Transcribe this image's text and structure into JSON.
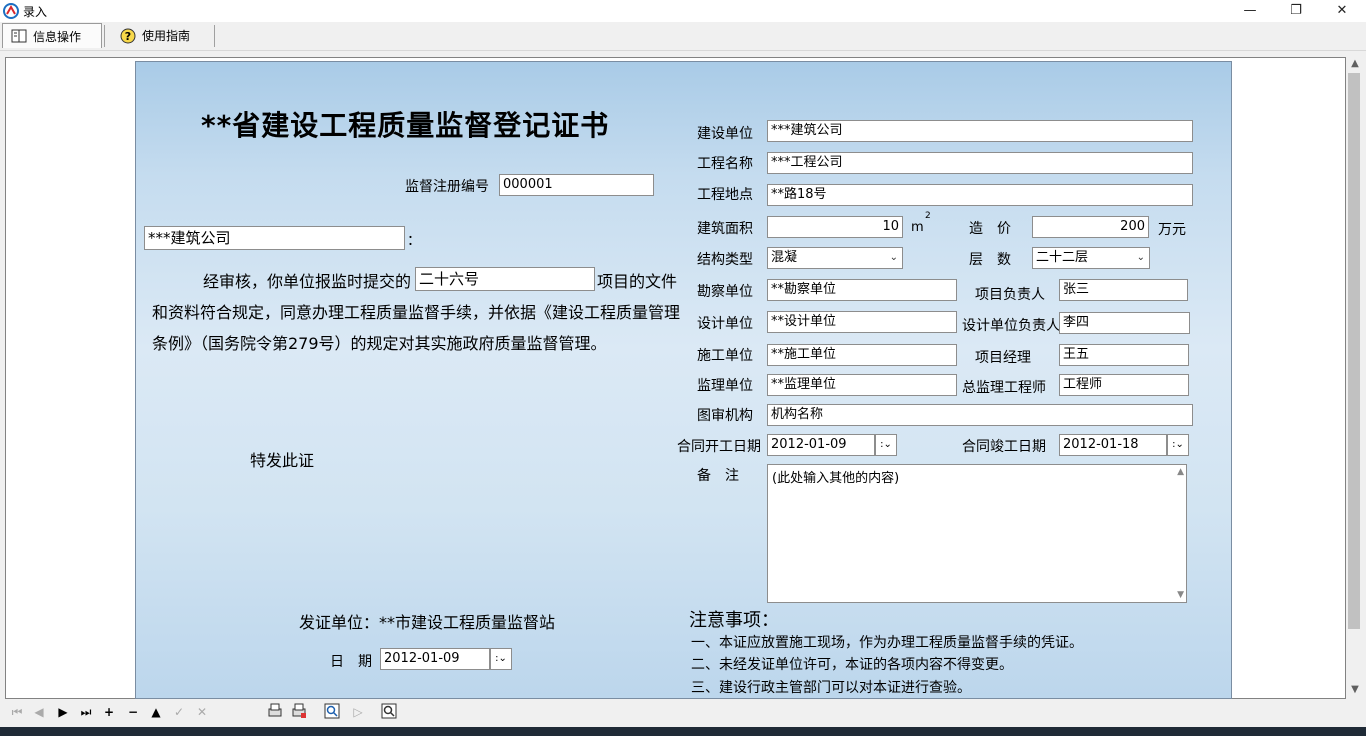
{
  "window": {
    "title": "录入",
    "minimize": "—",
    "restore": "❐",
    "close": "✕"
  },
  "toolbar": {
    "info_tab": "信息操作",
    "guide_tab": "使用指南"
  },
  "certificate": {
    "title": "**省建设工程质量监督登记证书",
    "reg_no_label": "监督注册编号",
    "reg_no": "000001",
    "company": "***建筑公司",
    "colon": "：",
    "body_prefix": "经审核，你单位报监时提交的",
    "project_ref": "二十六号",
    "body_suffix": "项目的文件",
    "body_line2": "和资料符合规定，同意办理工程质量监督手续，并依据《建设工程质量管理",
    "body_line3": "条例》（国务院令第279号）的规定对其实施政府质量监督管理。",
    "special_cert": "特发此证",
    "issuer": "发证单位：**市建设工程质量监督站",
    "date_label": "日　期",
    "date": "2012-01-09"
  },
  "fields": {
    "builder_label": "建设单位",
    "builder": "***建筑公司",
    "project_name_label": "工程名称",
    "project_name": "***工程公司",
    "location_label": "工程地点",
    "location": "**路18号",
    "area_label": "建筑面积",
    "area": "10",
    "area_unit": "m",
    "area_sup": "2",
    "cost_label": "造　价",
    "cost": "200",
    "cost_unit": "万元",
    "structure_label": "结构类型",
    "structure": "混凝",
    "floors_label": "层　数",
    "floors": "二十二层",
    "survey_label": "勘察单位",
    "survey": "**勘察单位",
    "pm_label": "项目负责人",
    "pm": "张三",
    "design_label": "设计单位",
    "design": "**设计单位",
    "design_lead_label": "设计单位负责人",
    "design_lead": "李四",
    "construct_label": "施工单位",
    "construct": "**施工单位",
    "manager_label": "项目经理",
    "manager": "王五",
    "supervise_label": "监理单位",
    "supervise": "**监理单位",
    "chief_label": "总监理工程师",
    "chief": "工程师",
    "review_label": "图审机构",
    "review": "机构名称",
    "start_label": "合同开工日期",
    "start": "2012-01-09",
    "end_label": "合同竣工日期",
    "end": "2012-01-18",
    "remark_label": "备　注",
    "remark": "(此处输入其他的内容)"
  },
  "notes": {
    "title": "注意事项：",
    "items": [
      "一、本证应放置施工现场，作为办理工程质量监督手续的凭证。",
      "二、未经发证单位许可，本证的各项内容不得变更。",
      "三、建设行政主管部门可以对本证进行查验。"
    ]
  }
}
